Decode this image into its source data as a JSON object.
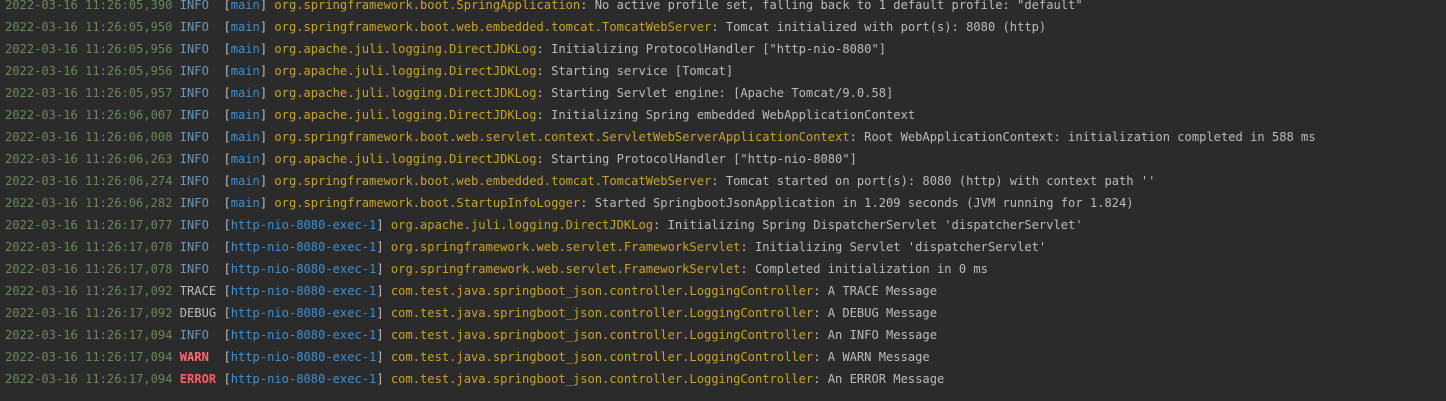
{
  "colors": {
    "background": "#2b2b2b",
    "timestamp": "#6a8759",
    "info": "#6897bb",
    "trace": "#bbbbbb",
    "debug": "#bbbbbb",
    "warn": "#ff6b68",
    "error": "#ff5f5f",
    "bracket": "#bbbbbb",
    "thread": "#3d8fd1",
    "logger": "#c9a227",
    "message": "#bbbbbb"
  },
  "console": {
    "lines": [
      {
        "timestamp": "2022-03-16 11:26:05,390",
        "level": "INFO",
        "level_pad": " ",
        "thread": "main",
        "logger": "org.springframework.boot.SpringApplication",
        "message": ": No active profile set, falling back to 1 default profile: \"default\""
      },
      {
        "timestamp": "2022-03-16 11:26:05,950",
        "level": "INFO",
        "level_pad": " ",
        "thread": "main",
        "logger": "org.springframework.boot.web.embedded.tomcat.TomcatWebServer",
        "message": ": Tomcat initialized with port(s): 8080 (http)"
      },
      {
        "timestamp": "2022-03-16 11:26:05,956",
        "level": "INFO",
        "level_pad": " ",
        "thread": "main",
        "logger": "org.apache.juli.logging.DirectJDKLog",
        "message": ": Initializing ProtocolHandler [\"http-nio-8080\"]"
      },
      {
        "timestamp": "2022-03-16 11:26:05,956",
        "level": "INFO",
        "level_pad": " ",
        "thread": "main",
        "logger": "org.apache.juli.logging.DirectJDKLog",
        "message": ": Starting service [Tomcat]"
      },
      {
        "timestamp": "2022-03-16 11:26:05,957",
        "level": "INFO",
        "level_pad": " ",
        "thread": "main",
        "logger": "org.apache.juli.logging.DirectJDKLog",
        "message": ": Starting Servlet engine: [Apache Tomcat/9.0.58]"
      },
      {
        "timestamp": "2022-03-16 11:26:06,007",
        "level": "INFO",
        "level_pad": " ",
        "thread": "main",
        "logger": "org.apache.juli.logging.DirectJDKLog",
        "message": ": Initializing Spring embedded WebApplicationContext"
      },
      {
        "timestamp": "2022-03-16 11:26:06,008",
        "level": "INFO",
        "level_pad": " ",
        "thread": "main",
        "logger": "org.springframework.boot.web.servlet.context.ServletWebServerApplicationContext",
        "message": ": Root WebApplicationContext: initialization completed in 588 ms"
      },
      {
        "timestamp": "2022-03-16 11:26:06,263",
        "level": "INFO",
        "level_pad": " ",
        "thread": "main",
        "logger": "org.apache.juli.logging.DirectJDKLog",
        "message": ": Starting ProtocolHandler [\"http-nio-8080\"]"
      },
      {
        "timestamp": "2022-03-16 11:26:06,274",
        "level": "INFO",
        "level_pad": " ",
        "thread": "main",
        "logger": "org.springframework.boot.web.embedded.tomcat.TomcatWebServer",
        "message": ": Tomcat started on port(s): 8080 (http) with context path ''"
      },
      {
        "timestamp": "2022-03-16 11:26:06,282",
        "level": "INFO",
        "level_pad": " ",
        "thread": "main",
        "logger": "org.springframework.boot.StartupInfoLogger",
        "message": ": Started SpringbootJsonApplication in 1.209 seconds (JVM running for 1.824)"
      },
      {
        "timestamp": "2022-03-16 11:26:17,077",
        "level": "INFO",
        "level_pad": " ",
        "thread": "http-nio-8080-exec-1",
        "logger": "org.apache.juli.logging.DirectJDKLog",
        "message": ": Initializing Spring DispatcherServlet 'dispatcherServlet'"
      },
      {
        "timestamp": "2022-03-16 11:26:17,078",
        "level": "INFO",
        "level_pad": " ",
        "thread": "http-nio-8080-exec-1",
        "logger": "org.springframework.web.servlet.FrameworkServlet",
        "message": ": Initializing Servlet 'dispatcherServlet'"
      },
      {
        "timestamp": "2022-03-16 11:26:17,078",
        "level": "INFO",
        "level_pad": " ",
        "thread": "http-nio-8080-exec-1",
        "logger": "org.springframework.web.servlet.FrameworkServlet",
        "message": ": Completed initialization in 0 ms"
      },
      {
        "timestamp": "2022-03-16 11:26:17,092",
        "level": "TRACE",
        "level_pad": "",
        "thread": "http-nio-8080-exec-1",
        "logger": "com.test.java.springboot_json.controller.LoggingController",
        "message": ": A TRACE Message"
      },
      {
        "timestamp": "2022-03-16 11:26:17,092",
        "level": "DEBUG",
        "level_pad": "",
        "thread": "http-nio-8080-exec-1",
        "logger": "com.test.java.springboot_json.controller.LoggingController",
        "message": ": A DEBUG Message"
      },
      {
        "timestamp": "2022-03-16 11:26:17,094",
        "level": "INFO",
        "level_pad": " ",
        "thread": "http-nio-8080-exec-1",
        "logger": "com.test.java.springboot_json.controller.LoggingController",
        "message": ": An INFO Message"
      },
      {
        "timestamp": "2022-03-16 11:26:17,094",
        "level": "WARN",
        "level_pad": " ",
        "thread": "http-nio-8080-exec-1",
        "logger": "com.test.java.springboot_json.controller.LoggingController",
        "message": ": A WARN Message"
      },
      {
        "timestamp": "2022-03-16 11:26:17,094",
        "level": "ERROR",
        "level_pad": "",
        "thread": "http-nio-8080-exec-1",
        "logger": "com.test.java.springboot_json.controller.LoggingController",
        "message": ": An ERROR Message"
      }
    ]
  }
}
